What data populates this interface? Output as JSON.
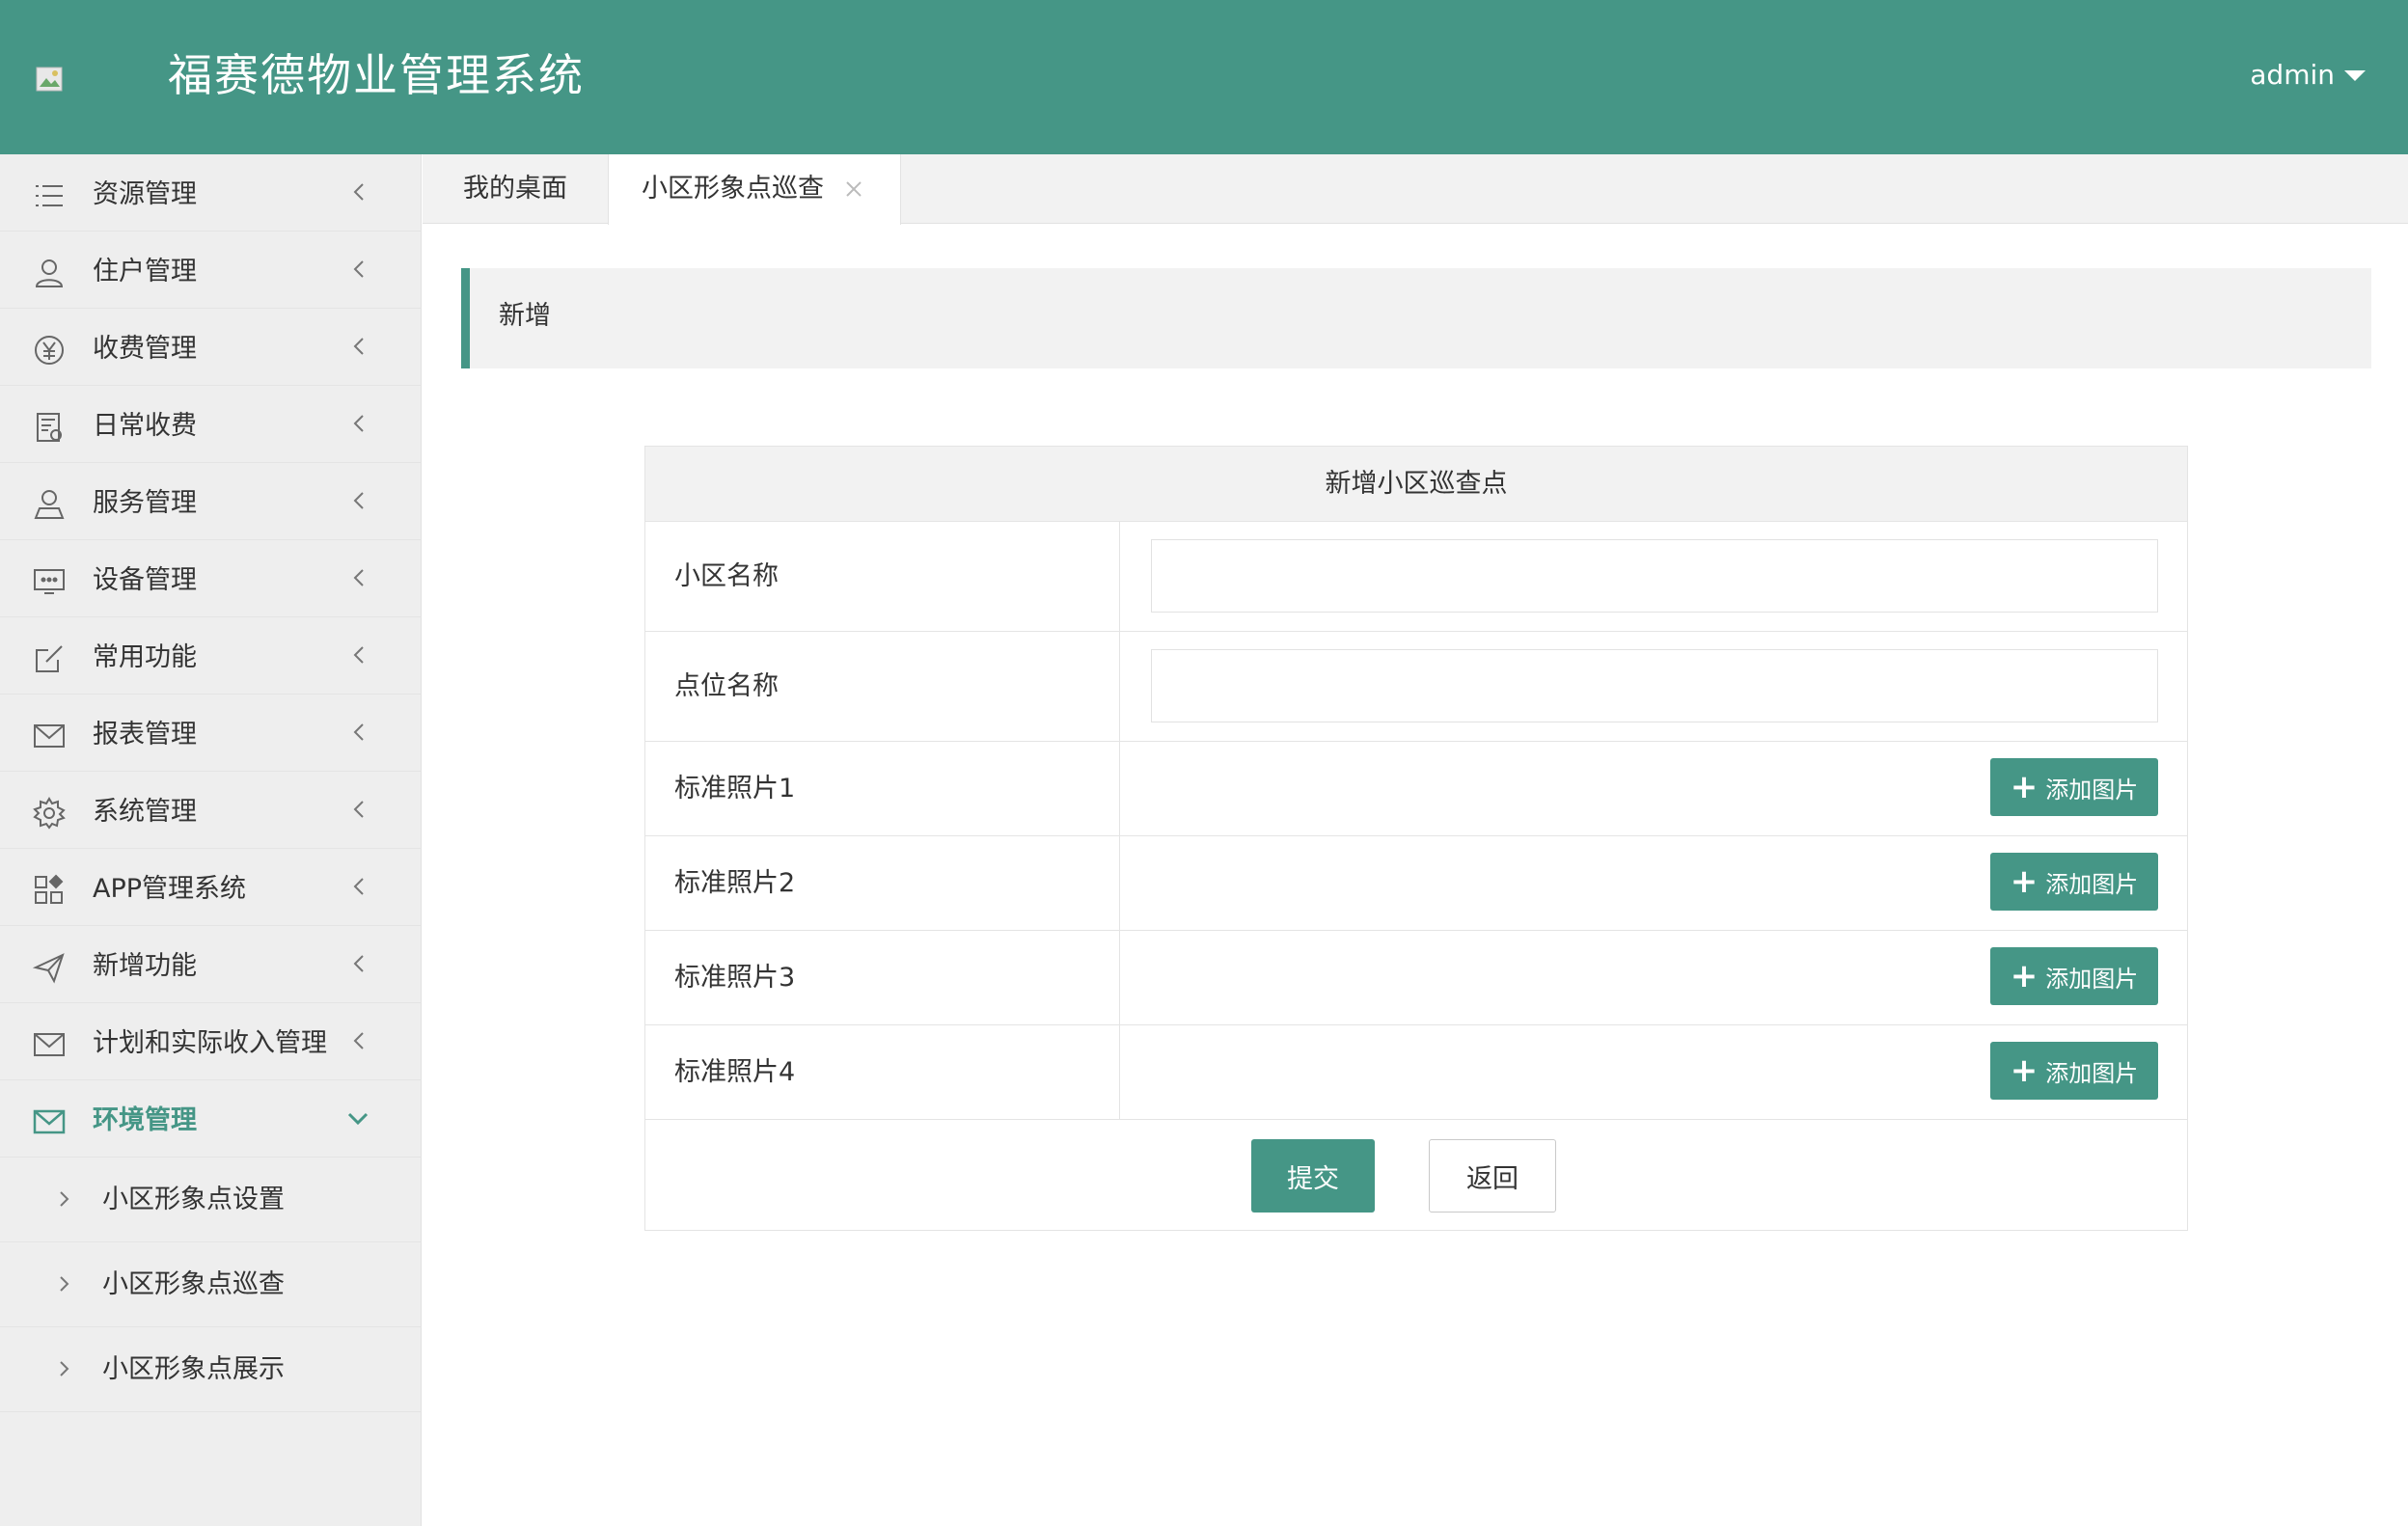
{
  "header": {
    "title": "福赛德物业管理系统",
    "user": "admin",
    "bg_color": "#459686"
  },
  "sidebar": {
    "items": [
      {
        "label": "资源管理",
        "icon": "list-icon"
      },
      {
        "label": "住户管理",
        "icon": "user-icon"
      },
      {
        "label": "收费管理",
        "icon": "yen-icon"
      },
      {
        "label": "日常收费",
        "icon": "calculator-icon"
      },
      {
        "label": "服务管理",
        "icon": "person-icon"
      },
      {
        "label": "设备管理",
        "icon": "device-icon"
      },
      {
        "label": "常用功能",
        "icon": "edit-icon"
      },
      {
        "label": "报表管理",
        "icon": "mail-icon"
      },
      {
        "label": "系统管理",
        "icon": "gear-icon"
      },
      {
        "label": "APP管理系统",
        "icon": "apps-icon"
      },
      {
        "label": "新增功能",
        "icon": "send-icon"
      },
      {
        "label": "计划和实际收入管理",
        "icon": "mail-icon"
      },
      {
        "label": "环境管理",
        "icon": "mail-icon"
      }
    ],
    "sub_items": [
      {
        "label": "小区形象点设置"
      },
      {
        "label": "小区形象点巡查"
      },
      {
        "label": "小区形象点展示"
      }
    ]
  },
  "tabs": {
    "home": "我的桌面",
    "current": "小区形象点巡查"
  },
  "section": {
    "title": "新增"
  },
  "form": {
    "heading": "新增小区巡查点",
    "community_name_label": "小区名称",
    "community_name_value": "",
    "point_name_label": "点位名称",
    "point_name_value": "",
    "photos": [
      {
        "label": "标准照片1",
        "button": "添加图片"
      },
      {
        "label": "标准照片2",
        "button": "添加图片"
      },
      {
        "label": "标准照片3",
        "button": "添加图片"
      },
      {
        "label": "标准照片4",
        "button": "添加图片"
      }
    ],
    "submit": "提交",
    "back": "返回"
  },
  "colors": {
    "accent": "#459686",
    "sidebar_bg": "#eeeeee",
    "active_text": "#459686"
  }
}
